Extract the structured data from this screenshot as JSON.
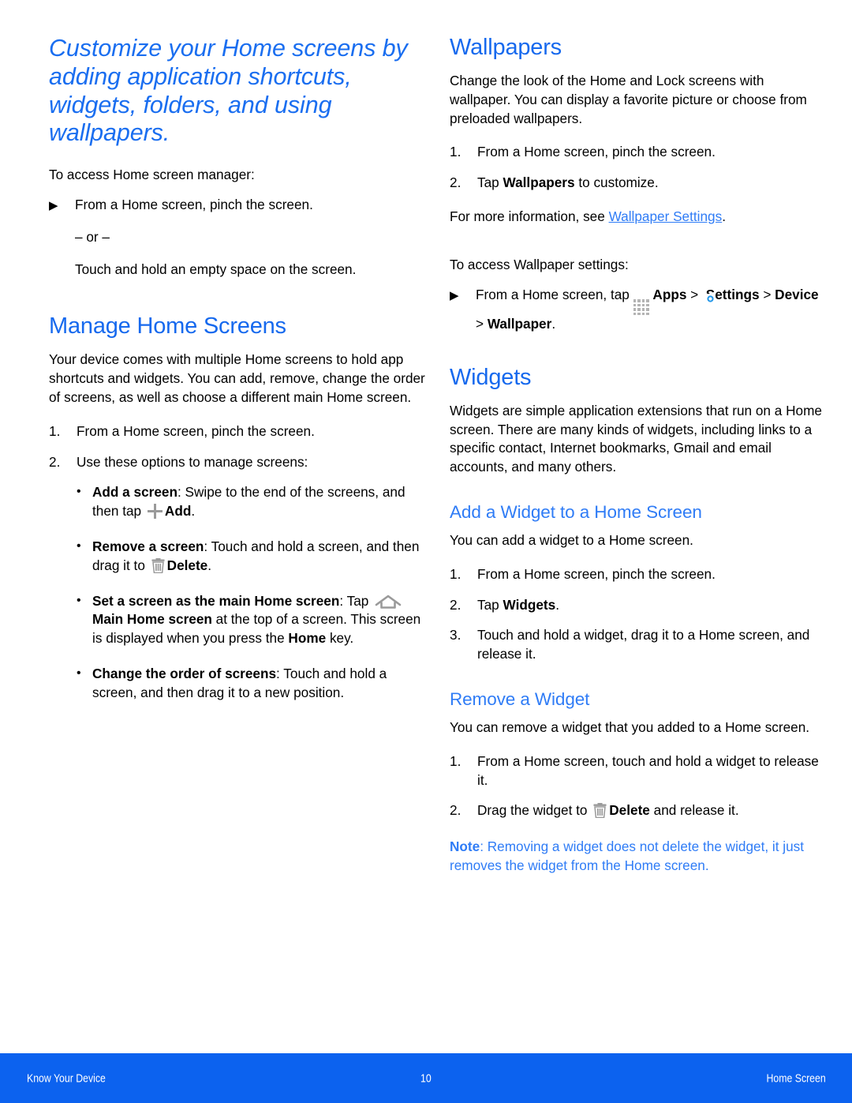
{
  "document": {
    "colors": {
      "heading_blue": "#1669ee",
      "subheading_blue": "#2f7cf6",
      "footer_blue": "#0c62ef",
      "body_black": "#000000",
      "icon_gray": "#9a9a9a"
    }
  },
  "left_column": {
    "chapter_title": "Customize your Home screens by adding application shortcuts, widgets, folders, and using wallpapers.",
    "intro_lead": "To access Home screen manager:",
    "intro_step": "From a Home screen, pinch the screen.",
    "intro_or": "– or –",
    "intro_alt": "Touch and hold an empty space on the screen.",
    "manage_heading": "Manage Home Screens",
    "manage_body": "Your device comes with multiple Home screens to hold app shortcuts and widgets. You can add, remove, change the order of screens, as well as choose a different main Home screen.",
    "manage_steps": [
      "From a Home screen, pinch the screen.",
      "Use these options to manage screens:"
    ],
    "bullets": [
      {
        "term": "Add a screen",
        "text_before_icon": ": Swipe to the end of the screens, and then tap ",
        "icon": "plus-icon",
        "bold_after_icon": "Add",
        "text_after": "."
      },
      {
        "term": "Remove a screen",
        "text_before_icon": ": Touch and hold a screen, and then drag it to ",
        "icon": "trash-icon",
        "bold_after_icon": "Delete",
        "text_after": "."
      },
      {
        "term": "Set a screen as the main Home screen",
        "text_before_icon": ": Tap ",
        "icon": "home-icon",
        "bold_after_icon": "Main Home screen",
        "text_after": " at the top of a screen. This screen is displayed when you press the ",
        "bold_tail": "Home",
        "text_tail": " key."
      },
      {
        "term": "Change the order of screens",
        "text_before_icon": ": Touch and hold a screen, and then drag it to a new position.",
        "icon": "",
        "bold_after_icon": "",
        "text_after": ""
      }
    ]
  },
  "right_column": {
    "wallpapers_heading": "Wallpapers",
    "wallpapers_body": "Change the look of the Home and Lock screens with wallpaper. You can display a favorite picture or choose from preloaded wallpapers.",
    "wallpapers_steps": [
      {
        "prefix": "From a Home screen, pinch the screen.",
        "bold": "",
        "suffix": ""
      },
      {
        "prefix": "Tap ",
        "bold": "Wallpapers",
        "suffix": " to customize."
      }
    ],
    "more_info_prefix": "For more information, see ",
    "more_info_link": "Wallpaper Settings",
    "more_info_suffix": ".",
    "access_lead": "To access Wallpaper settings:",
    "access_step": {
      "text_1": "From a Home screen, tap ",
      "icon_1": "apps-grid-icon",
      "bold_1": "Apps",
      "text_2": " > ",
      "icon_2": "settings-gear-icon",
      "bold_2": "Settings",
      "text_3": " > ",
      "bold_3": "Device",
      "text_4": " > ",
      "bold_4": "Wallpaper",
      "text_5": "."
    },
    "widgets_heading": "Widgets",
    "widgets_body": "Widgets are simple application extensions that run on a Home screen. There are many kinds of widgets, including links to a specific contact, Internet bookmarks, Gmail and email accounts, and many others.",
    "add_widget_heading": "Add a Widget to a Home Screen",
    "add_widget_body": "You can add a widget to a Home screen.",
    "add_widget_steps": [
      {
        "prefix": "From a Home screen, pinch the screen.",
        "bold": "",
        "suffix": ""
      },
      {
        "prefix": "Tap ",
        "bold": "Widgets",
        "suffix": "."
      },
      {
        "prefix": "Touch and hold a widget, drag it to a Home screen, and release it.",
        "bold": "",
        "suffix": ""
      }
    ],
    "remove_widget_heading": "Remove a Widget",
    "remove_widget_body": "You can remove a widget that you added to a Home screen.",
    "remove_widget_step1": "From a Home screen, touch and hold a widget to release it.",
    "remove_widget_step2": {
      "prefix": "Drag the widget to ",
      "icon": "trash-icon",
      "bold": "Delete",
      "suffix": " and release it."
    },
    "note_label": "Note",
    "note_text": ": Removing a widget does not delete the widget, it just removes the widget from the Home screen."
  },
  "footer": {
    "left": "Know Your Device",
    "page_number": "10",
    "right": "Home Screen"
  }
}
